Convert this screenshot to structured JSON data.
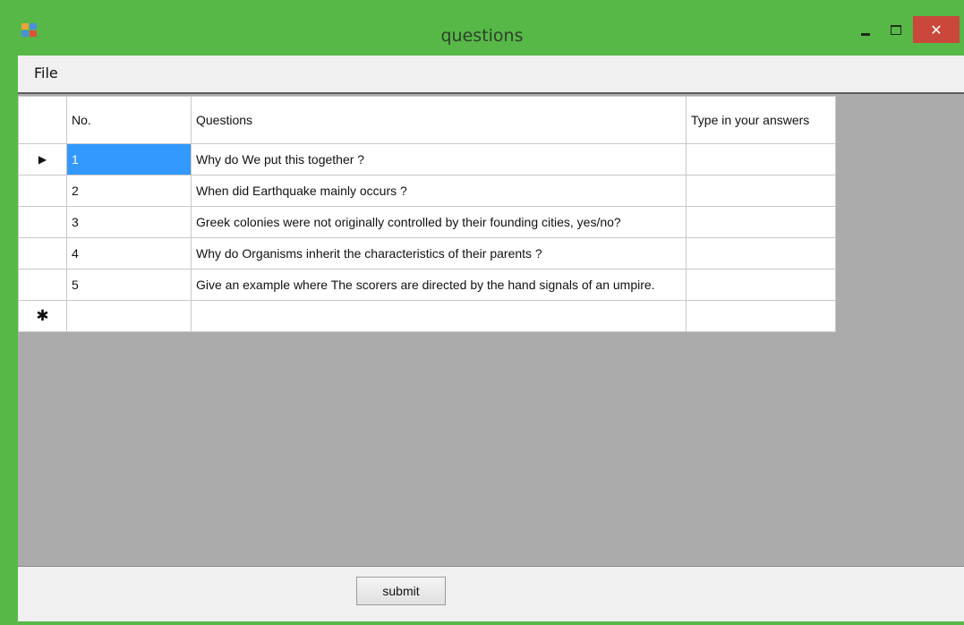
{
  "window": {
    "title": "questions",
    "close_glyph": "✕",
    "icons": [
      "app-icon",
      "minimize-icon",
      "maximize-icon",
      "close-icon"
    ],
    "frame_color": "#57b848",
    "close_color": "#c9483b"
  },
  "menu": {
    "file_label": "File"
  },
  "grid": {
    "headers": {
      "no": "No.",
      "questions": "Questions",
      "answers": "Type in your answers"
    },
    "current_row_glyph": "▶",
    "new_row_glyph": "✱",
    "selection_color": "#3399ff",
    "rows": [
      {
        "no": "1",
        "question": "Why do We put this together ?",
        "answer": ""
      },
      {
        "no": "2",
        "question": "When did Earthquake mainly occurs ?",
        "answer": ""
      },
      {
        "no": "3",
        "question": "Greek colonies were not originally controlled by their founding cities,  yes/no?",
        "answer": ""
      },
      {
        "no": "4",
        "question": "Why do Organisms inherit the characteristics of their parents ?",
        "answer": ""
      },
      {
        "no": "5",
        "question": "Give an example where The scorers are directed by the hand signals of an umpire.",
        "answer": ""
      }
    ]
  },
  "footer": {
    "submit_label": "submit"
  }
}
